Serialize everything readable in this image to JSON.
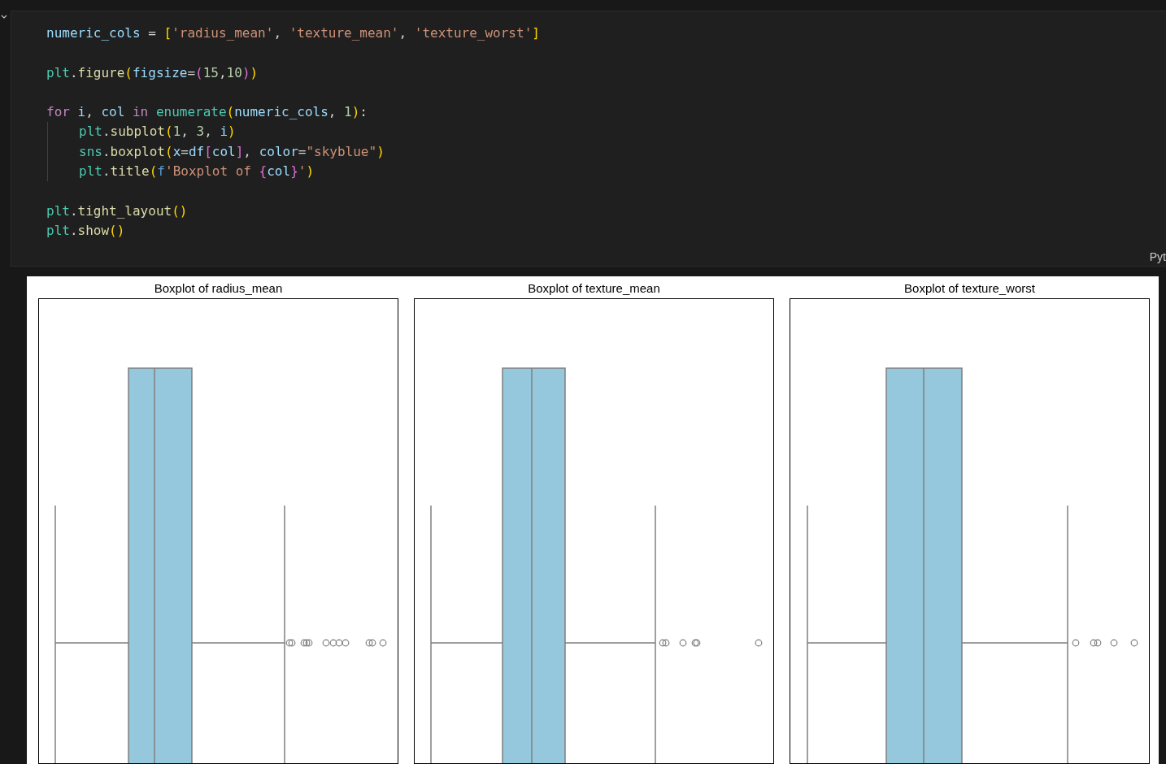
{
  "code_cell": {
    "lines": [
      {
        "indented": false,
        "tokens": [
          {
            "text": "numeric_cols",
            "kind": "var"
          },
          {
            "text": " = ",
            "kind": "op"
          },
          {
            "text": "[",
            "kind": "b1"
          },
          {
            "text": "'radius_mean'",
            "kind": "str"
          },
          {
            "text": ", ",
            "kind": "op"
          },
          {
            "text": "'texture_mean'",
            "kind": "str"
          },
          {
            "text": ", ",
            "kind": "op"
          },
          {
            "text": "'texture_worst'",
            "kind": "str"
          },
          {
            "text": "]",
            "kind": "b1"
          }
        ]
      },
      {
        "indented": false
      },
      {
        "indented": false,
        "tokens": [
          {
            "text": "plt",
            "kind": "mod"
          },
          {
            "text": ".",
            "kind": "op"
          },
          {
            "text": "figure",
            "kind": "fn"
          },
          {
            "text": "(",
            "kind": "b1"
          },
          {
            "text": "figsize",
            "kind": "var"
          },
          {
            "text": "=",
            "kind": "op"
          },
          {
            "text": "(",
            "kind": "b2"
          },
          {
            "text": "15",
            "kind": "num"
          },
          {
            "text": ",",
            "kind": "op"
          },
          {
            "text": "10",
            "kind": "num"
          },
          {
            "text": ")",
            "kind": "b2"
          },
          {
            "text": ")",
            "kind": "b1"
          }
        ]
      },
      {
        "indented": false
      },
      {
        "indented": false,
        "tokens": [
          {
            "text": "for",
            "kind": "kw"
          },
          {
            "text": " i",
            "kind": "var"
          },
          {
            "text": ", ",
            "kind": "op"
          },
          {
            "text": "col",
            "kind": "var"
          },
          {
            "text": " in ",
            "kind": "kw"
          },
          {
            "text": "enumerate",
            "kind": "mod"
          },
          {
            "text": "(",
            "kind": "b1"
          },
          {
            "text": "numeric_cols",
            "kind": "var"
          },
          {
            "text": ", ",
            "kind": "op"
          },
          {
            "text": "1",
            "kind": "num"
          },
          {
            "text": ")",
            "kind": "b1"
          },
          {
            "text": ":",
            "kind": "op"
          }
        ]
      },
      {
        "indented": true,
        "tokens": [
          {
            "text": "plt",
            "kind": "mod"
          },
          {
            "text": ".",
            "kind": "op"
          },
          {
            "text": "subplot",
            "kind": "fn"
          },
          {
            "text": "(",
            "kind": "b1"
          },
          {
            "text": "1",
            "kind": "num"
          },
          {
            "text": ", ",
            "kind": "op"
          },
          {
            "text": "3",
            "kind": "num"
          },
          {
            "text": ", ",
            "kind": "op"
          },
          {
            "text": "i",
            "kind": "var"
          },
          {
            "text": ")",
            "kind": "b1"
          }
        ]
      },
      {
        "indented": true,
        "tokens": [
          {
            "text": "sns",
            "kind": "mod"
          },
          {
            "text": ".",
            "kind": "op"
          },
          {
            "text": "boxplot",
            "kind": "fn"
          },
          {
            "text": "(",
            "kind": "b1"
          },
          {
            "text": "x",
            "kind": "var"
          },
          {
            "text": "=",
            "kind": "op"
          },
          {
            "text": "df",
            "kind": "var"
          },
          {
            "text": "[",
            "kind": "b2"
          },
          {
            "text": "col",
            "kind": "var"
          },
          {
            "text": "]",
            "kind": "b2"
          },
          {
            "text": ", ",
            "kind": "op"
          },
          {
            "text": "color",
            "kind": "var"
          },
          {
            "text": "=",
            "kind": "op"
          },
          {
            "text": "\"skyblue\"",
            "kind": "str"
          },
          {
            "text": ")",
            "kind": "b1"
          }
        ]
      },
      {
        "indented": true,
        "tokens": [
          {
            "text": "plt",
            "kind": "mod"
          },
          {
            "text": ".",
            "kind": "op"
          },
          {
            "text": "title",
            "kind": "fn"
          },
          {
            "text": "(",
            "kind": "b1"
          },
          {
            "text": "f",
            "kind": "b3"
          },
          {
            "text": "'Boxplot of ",
            "kind": "str"
          },
          {
            "text": "{",
            "kind": "b2"
          },
          {
            "text": "col",
            "kind": "var"
          },
          {
            "text": "}",
            "kind": "b2"
          },
          {
            "text": "'",
            "kind": "str"
          },
          {
            "text": ")",
            "kind": "b1"
          }
        ]
      },
      {
        "indented": false
      },
      {
        "indented": false,
        "tokens": [
          {
            "text": "plt",
            "kind": "mod"
          },
          {
            "text": ".",
            "kind": "op"
          },
          {
            "text": "tight_layout",
            "kind": "fn"
          },
          {
            "text": "()",
            "kind": "b1"
          }
        ]
      },
      {
        "indented": false,
        "tokens": [
          {
            "text": "plt",
            "kind": "mod"
          },
          {
            "text": ".",
            "kind": "op"
          },
          {
            "text": "show",
            "kind": "fn"
          },
          {
            "text": "()",
            "kind": "b1"
          }
        ]
      }
    ],
    "language": "Pyt"
  },
  "output": {
    "plots": [
      {
        "title": "Boxplot of radius_mean"
      },
      {
        "title": "Boxplot of texture_mean"
      },
      {
        "title": "Boxplot of texture_worst"
      }
    ]
  }
}
